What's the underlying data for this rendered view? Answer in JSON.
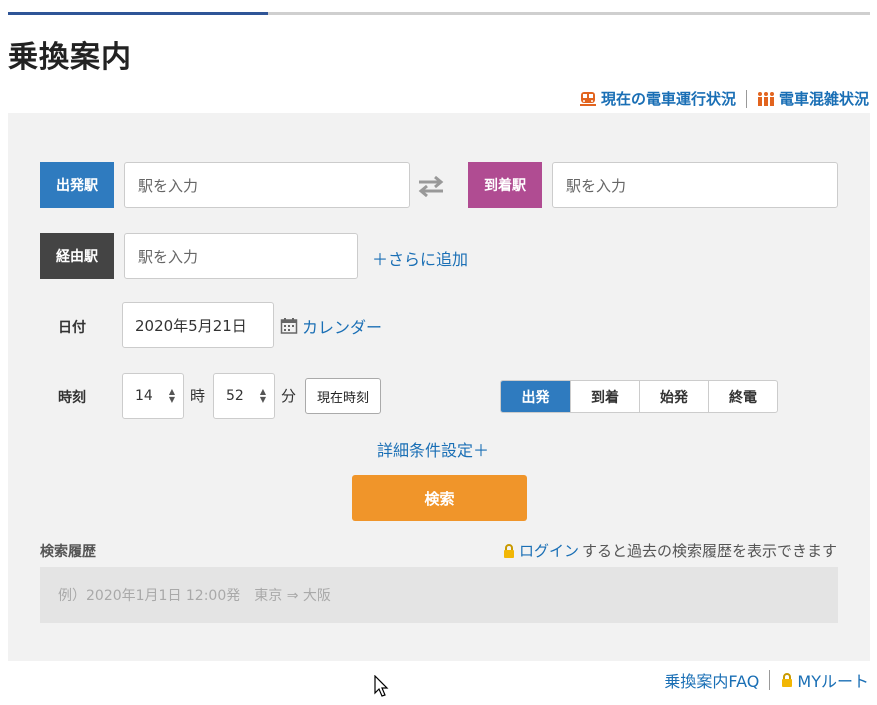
{
  "header": {
    "title": "乗換案内",
    "links": [
      {
        "label": "現在の電車運行状況",
        "icon": "train-icon"
      },
      {
        "label": "電車混雑状況",
        "icon": "crowd-icon"
      }
    ]
  },
  "form": {
    "departure": {
      "label": "出発駅",
      "placeholder": "駅を入力"
    },
    "arrival": {
      "label": "到着駅",
      "placeholder": "駅を入力"
    },
    "via": {
      "label": "経由駅",
      "placeholder": "駅を入力"
    },
    "add_more": "＋さらに追加",
    "date": {
      "label": "日付",
      "value": "2020年5月21日",
      "calendar_link": "カレンダー"
    },
    "time": {
      "label": "時刻",
      "hour": "14",
      "hour_unit": "時",
      "minute": "52",
      "minute_unit": "分",
      "now_button": "現在時刻"
    },
    "modes": [
      {
        "label": "出発",
        "active": true
      },
      {
        "label": "到着",
        "active": false
      },
      {
        "label": "始発",
        "active": false
      },
      {
        "label": "終電",
        "active": false
      }
    ],
    "detail_settings": "詳細条件設定＋",
    "search_button": "検索"
  },
  "history": {
    "label": "検索履歴",
    "login_link": "ログイン",
    "note": "すると過去の検索履歴を表示できます",
    "example": "例）2020年1月1日 12:00発　東京 ⇒ 大阪"
  },
  "footer": {
    "faq": "乗換案内FAQ",
    "my_route": "MYルート"
  },
  "colors": {
    "departure": "#2f7bbf",
    "arrival": "#b04c92",
    "via": "#444444",
    "search": "#f0952a",
    "link": "#1a6fb5"
  }
}
